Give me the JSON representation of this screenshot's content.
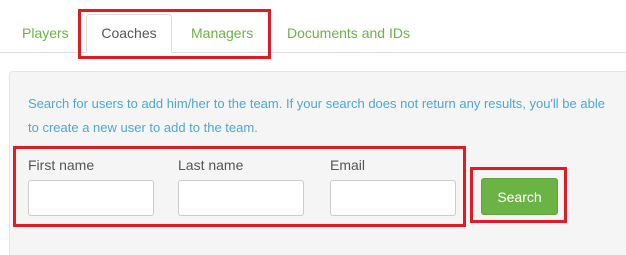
{
  "tabs": [
    {
      "label": "Players"
    },
    {
      "label": "Coaches",
      "active": true
    },
    {
      "label": "Managers"
    },
    {
      "label": "Documents and IDs"
    }
  ],
  "search_panel": {
    "hint": "Search for users to add him/her to the team. If your search does not return any results, you'll be able to create a new user to add to the team.",
    "fields": {
      "first_name": {
        "label": "First name",
        "value": "",
        "placeholder": ""
      },
      "last_name": {
        "label": "Last name",
        "value": "",
        "placeholder": ""
      },
      "email": {
        "label": "Email",
        "value": "",
        "placeholder": ""
      }
    },
    "search_button": {
      "label": "Search"
    }
  },
  "colors": {
    "accent_green": "#6bb344",
    "hint_blue": "#4aa8d8",
    "highlight_red": "#e01b24",
    "panel_bg": "#f5f5f5"
  }
}
